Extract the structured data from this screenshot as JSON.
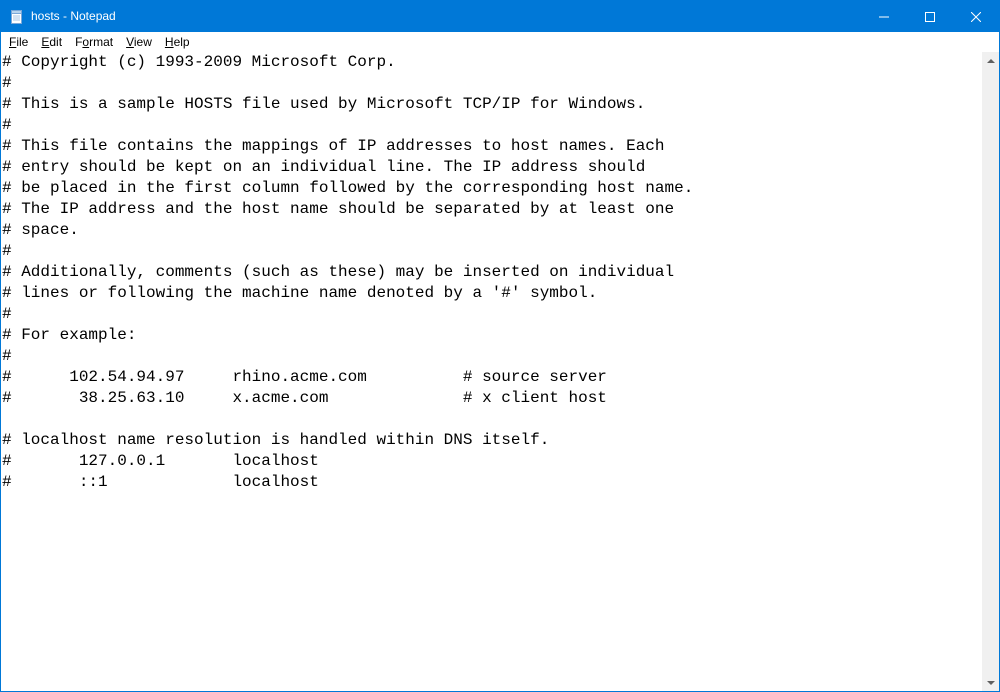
{
  "window": {
    "title": "hosts - Notepad"
  },
  "menu": {
    "file": "File",
    "edit": "Edit",
    "format": "Format",
    "view": "View",
    "help": "Help"
  },
  "content": "# Copyright (c) 1993-2009 Microsoft Corp.\n#\n# This is a sample HOSTS file used by Microsoft TCP/IP for Windows.\n#\n# This file contains the mappings of IP addresses to host names. Each\n# entry should be kept on an individual line. The IP address should\n# be placed in the first column followed by the corresponding host name.\n# The IP address and the host name should be separated by at least one\n# space.\n#\n# Additionally, comments (such as these) may be inserted on individual\n# lines or following the machine name denoted by a '#' symbol.\n#\n# For example:\n#\n#      102.54.94.97     rhino.acme.com          # source server\n#       38.25.63.10     x.acme.com              # x client host\n\n# localhost name resolution is handled within DNS itself.\n#\t127.0.0.1       localhost\n#\t::1             localhost"
}
